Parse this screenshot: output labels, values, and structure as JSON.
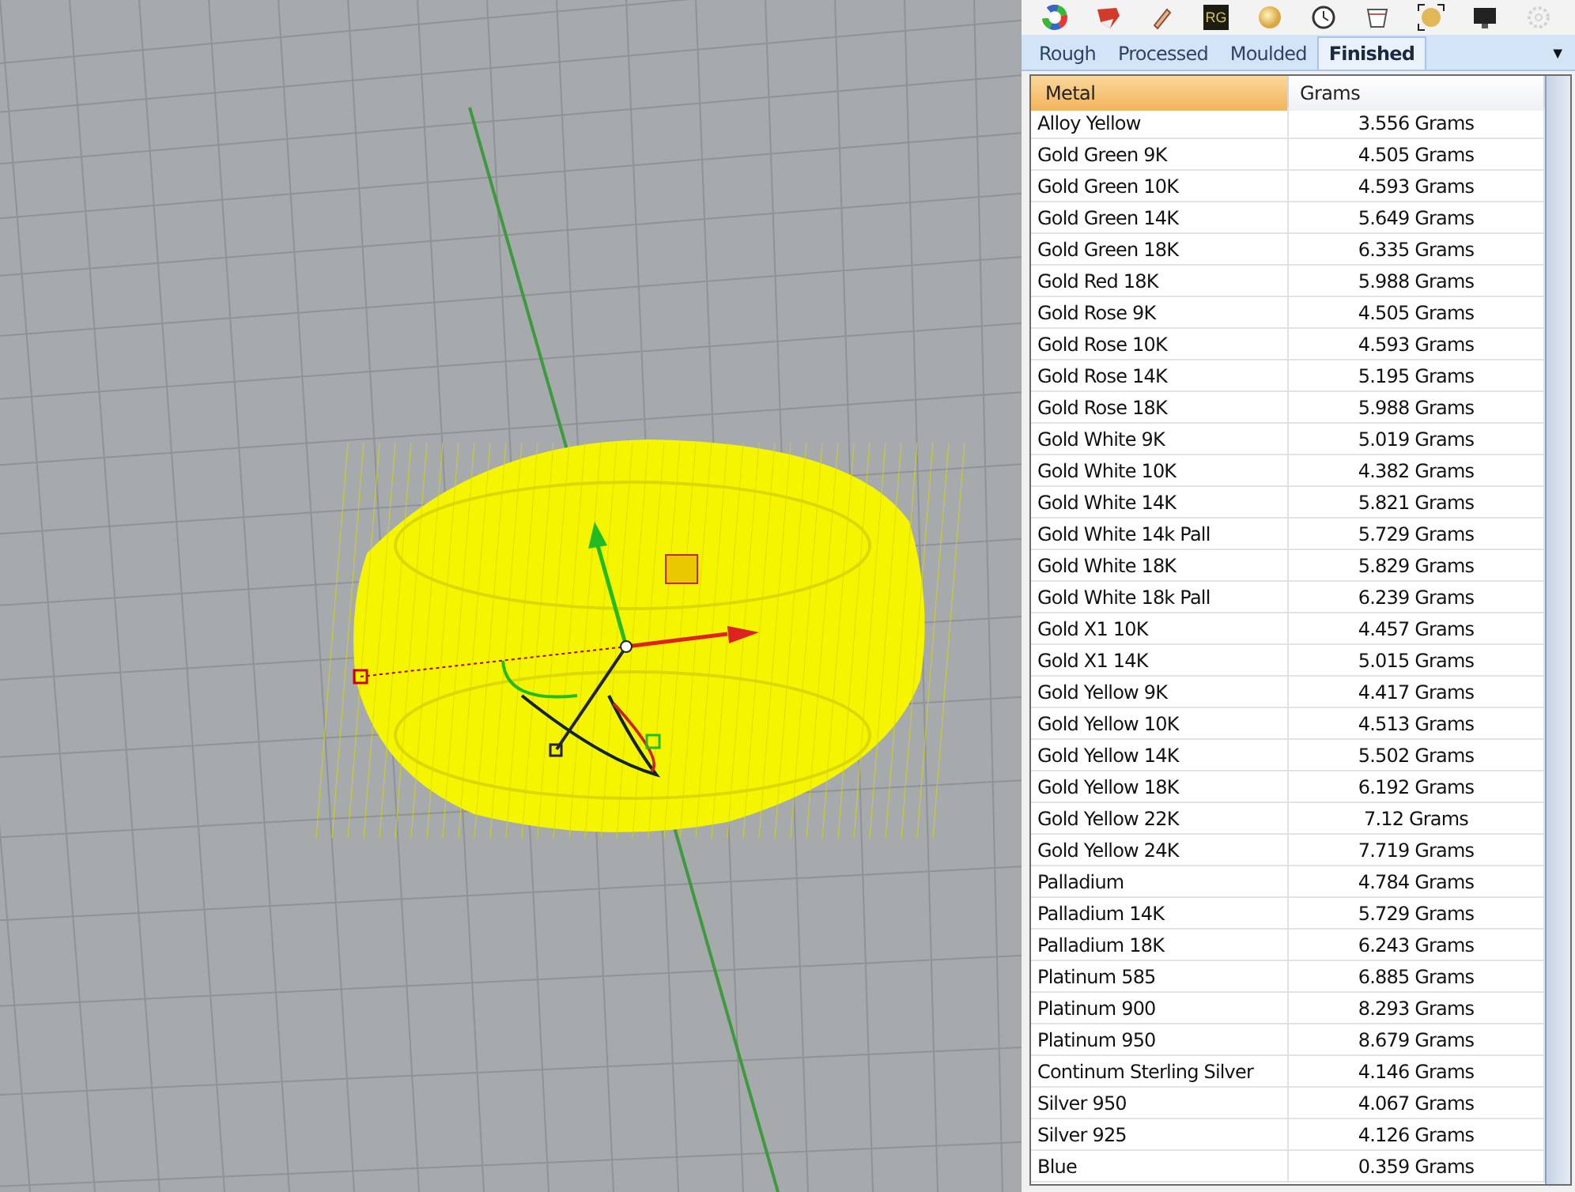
{
  "toolbar": {
    "icons": [
      {
        "kind": "wheel"
      },
      {
        "kind": "shield"
      },
      {
        "kind": "brush"
      },
      {
        "kind": "rg",
        "text": "RG"
      },
      {
        "kind": "sphere"
      },
      {
        "kind": "clock"
      },
      {
        "kind": "cup"
      },
      {
        "kind": "framed"
      },
      {
        "kind": "monitor"
      },
      {
        "kind": "gear",
        "disabled": true
      }
    ]
  },
  "tabs": [
    {
      "label": "Rough",
      "selected": false
    },
    {
      "label": "Processed",
      "selected": false
    },
    {
      "label": "Moulded",
      "selected": false
    },
    {
      "label": "Finished",
      "selected": true
    }
  ],
  "tabs_menu": "▼",
  "table": {
    "columns": [
      {
        "label": "Metal",
        "selected": true
      },
      {
        "label": "Grams",
        "selected": false
      }
    ],
    "rows": [
      [
        "Alloy Yellow",
        "3.556 Grams"
      ],
      [
        "Gold Green 9K",
        "4.505 Grams"
      ],
      [
        "Gold Green 10K",
        "4.593 Grams"
      ],
      [
        "Gold Green 14K",
        "5.649 Grams"
      ],
      [
        "Gold Green 18K",
        "6.335 Grams"
      ],
      [
        "Gold Red 18K",
        "5.988 Grams"
      ],
      [
        "Gold Rose 9K",
        "4.505 Grams"
      ],
      [
        "Gold Rose 10K",
        "4.593 Grams"
      ],
      [
        "Gold Rose 14K",
        "5.195 Grams"
      ],
      [
        "Gold Rose 18K",
        "5.988 Grams"
      ],
      [
        "Gold White 9K",
        "5.019 Grams"
      ],
      [
        "Gold White 10K",
        "4.382 Grams"
      ],
      [
        "Gold White 14K",
        "5.821 Grams"
      ],
      [
        "Gold White 14k Pall",
        "5.729 Grams"
      ],
      [
        "Gold White 18K",
        "5.829 Grams"
      ],
      [
        "Gold White 18k Pall",
        "6.239 Grams"
      ],
      [
        "Gold X1 10K",
        "4.457 Grams"
      ],
      [
        "Gold X1 14K",
        "5.015 Grams"
      ],
      [
        "Gold Yellow 9K",
        "4.417 Grams"
      ],
      [
        "Gold Yellow 10K",
        "4.513 Grams"
      ],
      [
        "Gold Yellow 14K",
        "5.502 Grams"
      ],
      [
        "Gold Yellow 18K",
        "6.192 Grams"
      ],
      [
        "Gold Yellow 22K",
        "7.12 Grams"
      ],
      [
        "Gold Yellow 24K",
        "7.719 Grams"
      ],
      [
        "Palladium",
        "4.784 Grams"
      ],
      [
        "Palladium 14K",
        "5.729 Grams"
      ],
      [
        "Palladium 18K",
        "6.243 Grams"
      ],
      [
        "Platinum 585",
        "6.885 Grams"
      ],
      [
        "Platinum 900",
        "8.293 Grams"
      ],
      [
        "Platinum 950",
        "8.679 Grams"
      ],
      [
        "Continum Sterling Silver",
        "4.146 Grams"
      ],
      [
        "Silver 950",
        "4.067 Grams"
      ],
      [
        "Silver 925",
        "4.126 Grams"
      ],
      [
        "Blue",
        "0.359 Grams"
      ]
    ]
  }
}
